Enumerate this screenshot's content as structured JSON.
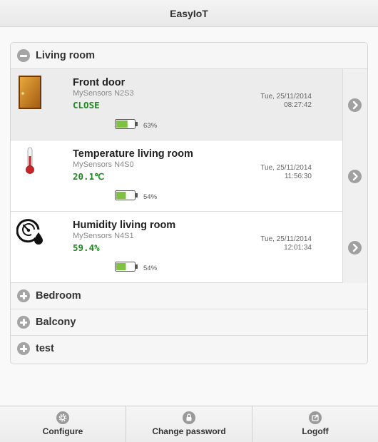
{
  "header": {
    "title": "EasyIoT"
  },
  "sections": {
    "living_room": {
      "label": "Living room",
      "expanded": true
    },
    "bedroom": {
      "label": "Bedroom",
      "expanded": false
    },
    "balcony": {
      "label": "Balcony",
      "expanded": false
    },
    "test": {
      "label": "test",
      "expanded": false
    }
  },
  "devices": [
    {
      "name": "Front door",
      "node": "MySensors N2S3",
      "value": "CLOSE",
      "date": "Tue, 25/11/2014",
      "time": "08:27:42",
      "battery": "63%",
      "battery_level": 0.63,
      "icon": "door-icon"
    },
    {
      "name": "Temperature living room",
      "node": "MySensors N4S0",
      "value": "20.1℃",
      "date": "Tue, 25/11/2014",
      "time": "11:56:30",
      "battery": "54%",
      "battery_level": 0.54,
      "icon": "thermometer-icon"
    },
    {
      "name": "Humidity living room",
      "node": "MySensors N4S1",
      "value": "59.4%",
      "date": "Tue, 25/11/2014",
      "time": "12:01:34",
      "battery": "54%",
      "battery_level": 0.54,
      "icon": "humidity-gauge-icon"
    }
  ],
  "footer": {
    "configure": {
      "label": "Configure",
      "icon": "gear-icon"
    },
    "change_password": {
      "label": "Change password",
      "icon": "lock-icon"
    },
    "logoff": {
      "label": "Logoff",
      "icon": "logoff-icon"
    }
  },
  "colors": {
    "value_green": "#1e8a1e",
    "toggle_gray": "#a4a4a4",
    "battery_green": "#7fc241"
  }
}
